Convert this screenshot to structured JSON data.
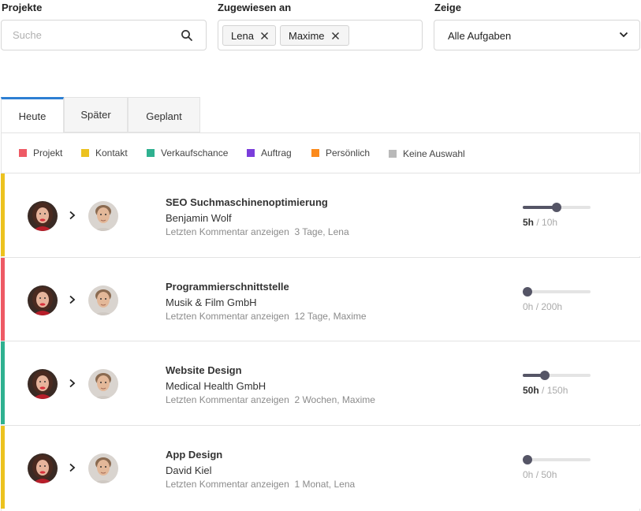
{
  "filters": {
    "projects": {
      "label": "Projekte",
      "search_placeholder": "Suche"
    },
    "assigned": {
      "label": "Zugewiesen an",
      "chips": [
        "Lena",
        "Maxime"
      ]
    },
    "show": {
      "label": "Zeige",
      "value": "Alle Aufgaben"
    }
  },
  "tabs": [
    {
      "label": "Heute",
      "active": true
    },
    {
      "label": "Später",
      "active": false
    },
    {
      "label": "Geplant",
      "active": false
    }
  ],
  "legend": [
    {
      "label": "Projekt",
      "color": "#ee5a65"
    },
    {
      "label": "Kontakt",
      "color": "#ecc21f"
    },
    {
      "label": "Verkaufschance",
      "color": "#2fb190"
    },
    {
      "label": "Auftrag",
      "color": "#7a3ddb"
    },
    {
      "label": "Persönlich",
      "color": "#fb8a1c"
    },
    {
      "label": "Keine Auswahl",
      "color": "#b9b9b9"
    }
  ],
  "tasks": [
    {
      "title": "SEO Suchmaschinenoptimierung",
      "client": "Benjamin Wolf",
      "comment_link": "Letzten Kommentar anzeigen",
      "comment_meta": "3 Tage, Lena",
      "logged": "5h",
      "total": "/ 10h",
      "progress": 0.5,
      "stripe_color": "#ecc21f"
    },
    {
      "title": "Programmierschnittstelle",
      "client": "Musik & Film GmbH",
      "comment_link": "Letzten Kommentar anzeigen",
      "comment_meta": "12 Tage, Maxime",
      "logged": "0h",
      "total": "/ 200h",
      "progress": 0.0,
      "stripe_color": "#ee5a65"
    },
    {
      "title": "Website Design",
      "client": "Medical Health GmbH",
      "comment_link": "Letzten Kommentar anzeigen",
      "comment_meta": "2 Wochen, Maxime",
      "logged": "50h",
      "total": "/ 150h",
      "progress": 0.33,
      "stripe_color": "#2fb190"
    },
    {
      "title": "App Design",
      "client": "David Kiel",
      "comment_link": "Letzten Kommentar anzeigen",
      "comment_meta": "1 Monat, Lena",
      "logged": "0h",
      "total": "/ 50h",
      "progress": 0.0,
      "stripe_color": "#ecc21f"
    }
  ]
}
